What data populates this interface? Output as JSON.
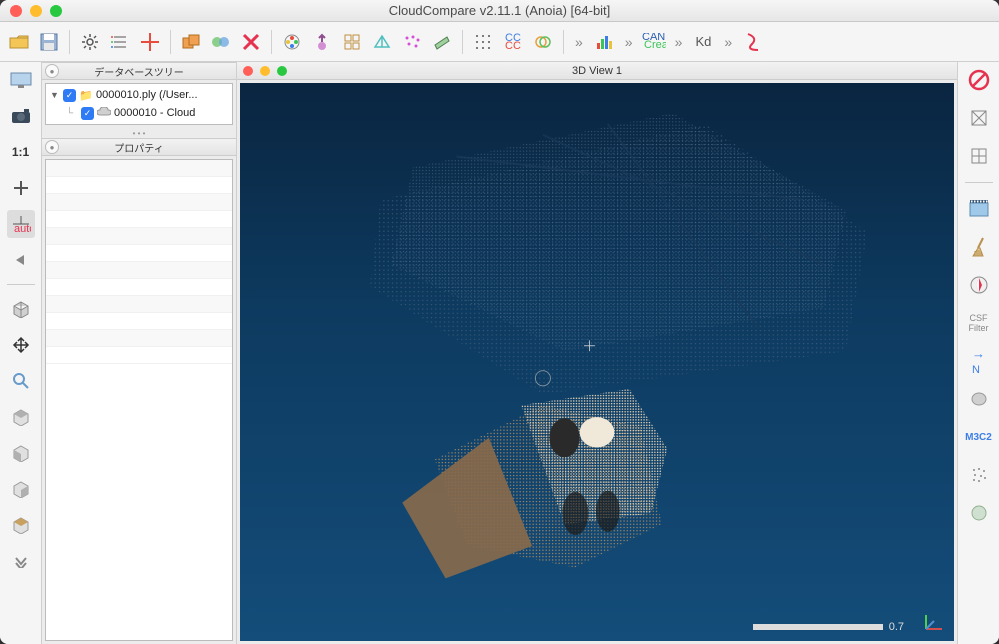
{
  "title": "CloudCompare v2.11.1 (Anoia) [64-bit]",
  "panels": {
    "tree_title": "データベースツリー",
    "props_title": "プロパティ"
  },
  "tree": {
    "root": {
      "name": "0000010.ply (/User...",
      "checked": true
    },
    "child": {
      "name": "0000010 - Cloud",
      "checked": true
    }
  },
  "view": {
    "title": "3D View 1",
    "scale_label": "0.7"
  },
  "rside": {
    "csf": "CSF Filter",
    "n": "N",
    "m3c2": "M3C2",
    "kd": "Kd"
  }
}
